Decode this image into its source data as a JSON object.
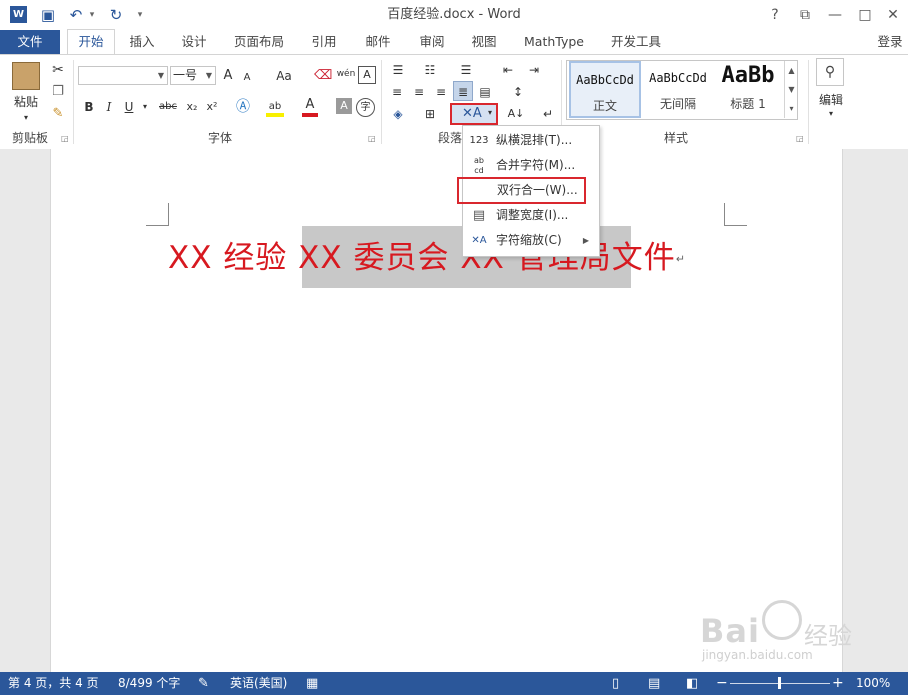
{
  "window": {
    "title": "百度经验.docx - Word"
  },
  "titlebar_icons": {
    "help": "?",
    "ribbon_display": "⧉",
    "minimize": "—",
    "maximize": "□",
    "close": "✕"
  },
  "tabs": [
    "文件",
    "开始",
    "插入",
    "设计",
    "页面布局",
    "引用",
    "邮件",
    "审阅",
    "视图",
    "MathType",
    "开发工具"
  ],
  "account": "登录",
  "ribbon": {
    "clipboard": {
      "paste_label": "粘贴",
      "group": "剪贴板"
    },
    "font": {
      "font_size": "一号",
      "group": "字体",
      "bold": "B",
      "italic": "I",
      "underline": "U",
      "strikethrough": "abc",
      "subscript": "x₂",
      "superscript": "x²",
      "grow": "A",
      "shrink": "A",
      "case": "Aa",
      "font_color": "A",
      "char_shading": "A",
      "enclose": "字",
      "phonetic": "wén"
    },
    "paragraph": {
      "group": "段落"
    },
    "styles": {
      "group": "样式",
      "items": [
        {
          "preview": "AaBbCcDd",
          "name": "正文"
        },
        {
          "preview": "AaBbCcDd",
          "name": "无间隔"
        },
        {
          "preview": "AaBb",
          "name": "标题 1"
        }
      ]
    },
    "editing": {
      "label": "编辑"
    }
  },
  "menu": {
    "items": [
      {
        "icon": "123",
        "label": "纵横混排(T)..."
      },
      {
        "icon": "ab\ncd",
        "label": "合并字符(M)..."
      },
      {
        "icon": "",
        "label": "双行合一(W)..."
      },
      {
        "icon": "▤",
        "label": "调整宽度(I)..."
      },
      {
        "icon": "✕A",
        "label": "字符缩放(C)",
        "submenu": true
      }
    ]
  },
  "document": {
    "text": "XX 经验 XX 委员会 XX 管理局文件",
    "para_mark": "↵"
  },
  "status": {
    "page": "第 4 页，共 4 页",
    "words": "8/499 个字",
    "language": "英语(美国)",
    "zoom": "100%"
  },
  "watermark": {
    "brand": "Bai",
    "brand2": "经验",
    "url": "jingyan.baidu.com"
  },
  "colors": {
    "accent": "#2b579a",
    "doc_text": "#d71920",
    "highlight_box": "#d9272e"
  }
}
